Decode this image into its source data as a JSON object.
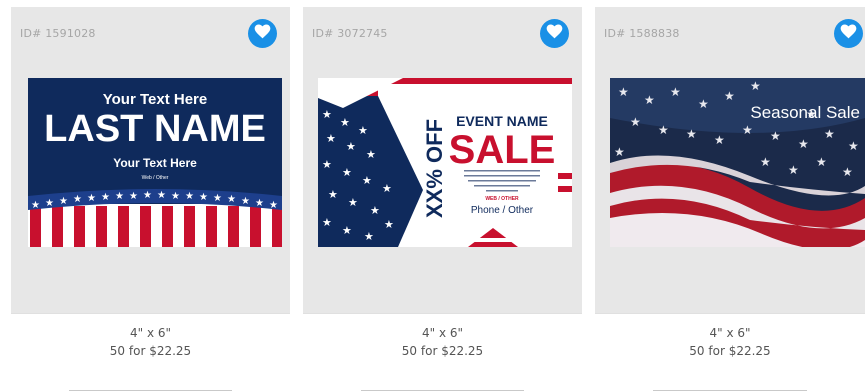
{
  "cards": [
    {
      "id_text": "ID# 1591028",
      "size": "4\" x 6\"",
      "price": "50 for $22.25",
      "design": {
        "line1": "Your Text Here",
        "line2": "LAST NAME",
        "line3": "Your Text Here",
        "line4": "Web / Other"
      }
    },
    {
      "id_text": "ID# 3072745",
      "size": "4\" x 6\"",
      "price": "50 for $22.25",
      "design": {
        "discount": "XX% OFF",
        "event": "EVENT NAME",
        "sale": "SALE",
        "web": "WEB / OTHER",
        "phone": "Phone / Other"
      }
    },
    {
      "id_text": "ID# 1588838",
      "size": "4\" x 6\"",
      "price": "50 for $22.25",
      "design": {
        "headline": "Seasonal Sale"
      }
    }
  ],
  "colors": {
    "favorite_button": "#1a90e6",
    "navy": "#0f2a5c",
    "red": "#c8102e"
  },
  "icons": {
    "favorite": "heart-icon"
  }
}
